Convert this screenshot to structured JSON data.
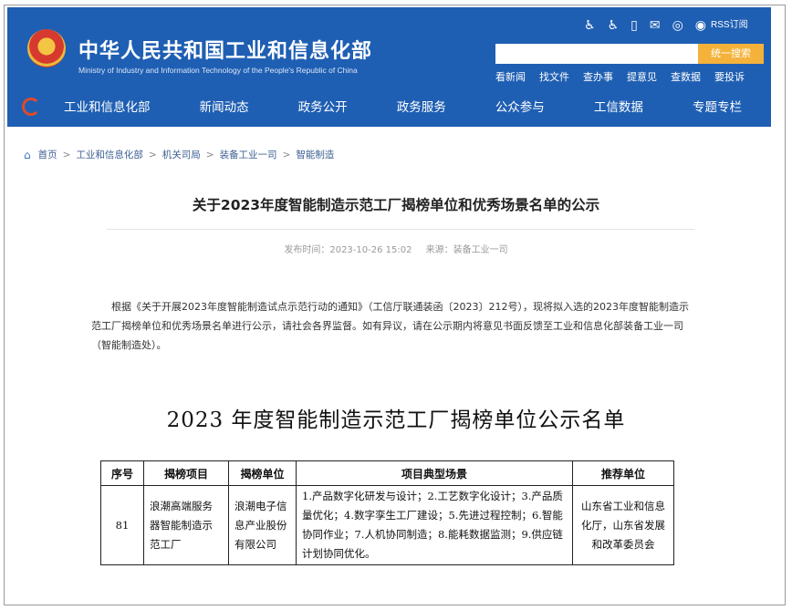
{
  "header": {
    "title": "中华人民共和国工业和信息化部",
    "subtitle": "Ministry of Industry and Information Technology of the People's Republic of China",
    "rss_label": "RSS订阅",
    "search_placeholder": "",
    "search_button": "统一搜索",
    "quick_links": [
      "看新闻",
      "找文件",
      "查办事",
      "提意见",
      "查数据",
      "要投诉"
    ],
    "nav": [
      "工业和信息化部",
      "新闻动态",
      "政务公开",
      "政务服务",
      "公众参与",
      "工信数据",
      "专题专栏"
    ],
    "brand_color": "#1f5fb3"
  },
  "breadcrumb": [
    "首页",
    "工业和信息化部",
    "机关司局",
    "装备工业一司",
    "智能制造"
  ],
  "article": {
    "title": "关于2023年度智能制造示范工厂揭榜单位和优秀场景名单的公示",
    "publish_time": "发布时间：2023-10-26 15:02",
    "source": "来源：装备工业一司",
    "paragraph": "根据《关于开展2023年度智能制造试点示范行动的通知》（工信厅联通装函〔2023〕212号），现将拟入选的2023年度智能制造示范工厂揭榜单位和优秀场景名单进行公示，请社会各界监督。如有异议，请在公示期内将意见书面反馈至工业和信息化部装备工业一司（智能制造处）。",
    "list_title": "2023 年度智能制造示范工厂揭榜单位公示名单"
  },
  "table": {
    "headers": [
      "序号",
      "揭榜项目",
      "揭榜单位",
      "项目典型场景",
      "推荐单位"
    ],
    "rows": [
      {
        "num": "81",
        "project": "浪潮高端服务器智能制造示范工厂",
        "unit": "浪潮电子信息产业股份有限公司",
        "scenes": "1.产品数字化研发与设计；2.工艺数字化设计；3.产品质量优化；4.数字孪生工厂建设；5.先进过程控制；6.智能协同作业；7.人机协同制造；8.能耗数据监测；9.供应链计划协同优化。",
        "recommender": "山东省工业和信息化厅，山东省发展和改革委员会"
      }
    ]
  }
}
